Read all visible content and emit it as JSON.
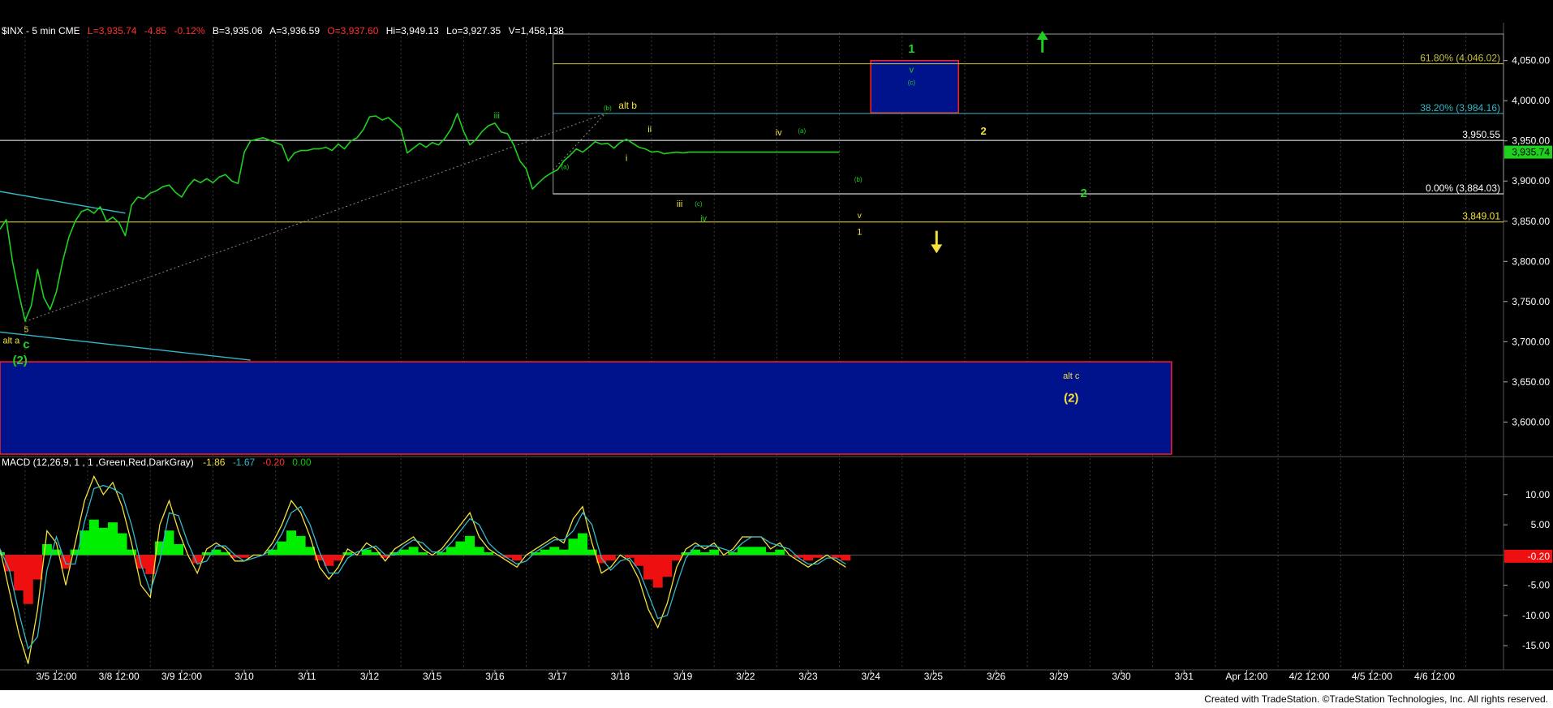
{
  "header": {
    "symbol": "$INX - 5 min  CME",
    "last": "L=3,935.74",
    "change": "-4.85",
    "pct": "-0.12%",
    "bid": "B=3,935.06",
    "ask": "A=3,936.59",
    "open": "O=3,937.60",
    "hi": "Hi=3,949.13",
    "lo": "Lo=3,927.35",
    "vol": "V=1,458,138"
  },
  "footer": {
    "text": "Created with TradeStation. ©TradeStation Technologies, Inc. All rights reserved."
  },
  "colors": {
    "price": "#1fd01f",
    "yellow": "#f2e23a",
    "cyan": "#33b8c8",
    "white": "#ffffff",
    "blue_box": "#00128c",
    "red": "#ff2020",
    "macd_green": "#00ee00",
    "macd_red": "#ee1010"
  },
  "chart_data": [
    {
      "type": "line",
      "title": "",
      "ylim": [
        3560,
        4085
      ],
      "y_ticks": [
        "4,050.00",
        "4,000.00",
        "3,950.00",
        "3,900.00",
        "3,850.00",
        "3,800.00",
        "3,750.00",
        "3,700.00",
        "3,650.00",
        "3,600.00"
      ],
      "y_tick_values": [
        4050,
        4000,
        3950,
        3900,
        3850,
        3800,
        3750,
        3700,
        3650,
        3600
      ],
      "x_ticks": [
        "3/5 12:00",
        "3/8 12:00",
        "3/9 12:00",
        "3/10",
        "3/11",
        "3/12",
        "3/15",
        "3/16",
        "3/17",
        "3/18",
        "3/19",
        "3/22",
        "3/23",
        "3/24",
        "3/25",
        "3/26",
        "3/29",
        "3/30",
        "3/31",
        "Apr 12:00",
        "4/2 12:00",
        "4/5 12:00",
        "4/6 12:00"
      ],
      "x_tick_pos": [
        0.5,
        1.5,
        2.5,
        3.5,
        4.5,
        5.5,
        6.5,
        7.5,
        8.5,
        9.5,
        10.5,
        11.5,
        12.5,
        13.5,
        14.5,
        15.5,
        16.5,
        17.5,
        18.5,
        19.5,
        20.5,
        21.5,
        22.5
      ],
      "xlim": [
        -0.4,
        23.6
      ],
      "series": [
        {
          "x": [
            -0.4,
            -0.3,
            -0.2,
            -0.1,
            0.0,
            0.1,
            0.2,
            0.3,
            0.4,
            0.5,
            0.6,
            0.7,
            0.8,
            0.9,
            1.0,
            1.1,
            1.2,
            1.3,
            1.4,
            1.5,
            1.6,
            1.7,
            1.8,
            1.9,
            2.0,
            2.1,
            2.2,
            2.3,
            2.4,
            2.5,
            2.6,
            2.7,
            2.8,
            2.9,
            3.0,
            3.1,
            3.2,
            3.3,
            3.4,
            3.5,
            3.6,
            3.7,
            3.8,
            3.9,
            4.0,
            4.1,
            4.2,
            4.3,
            4.4,
            4.5,
            4.6,
            4.7,
            4.8,
            4.9,
            5.0,
            5.1,
            5.2,
            5.3,
            5.4,
            5.5,
            5.6,
            5.7,
            5.8,
            5.9,
            6.0,
            6.1,
            6.2,
            6.3,
            6.4,
            6.5,
            6.6,
            6.7,
            6.8,
            6.9,
            7.0,
            7.1,
            7.2,
            7.3,
            7.4,
            7.5,
            7.6,
            7.7,
            7.8,
            7.9,
            8.0,
            8.1,
            8.2,
            8.3,
            8.4,
            8.5,
            8.6,
            8.7,
            8.8,
            8.9,
            9.0,
            9.1,
            9.2,
            9.3,
            9.4,
            9.5,
            9.6,
            9.7,
            9.8,
            9.9,
            10.0,
            10.1,
            10.2,
            10.3,
            10.4,
            10.5,
            10.6,
            10.7,
            10.8,
            10.9,
            11.0,
            11.1,
            11.2,
            11.3,
            11.4,
            11.5,
            11.6,
            11.7,
            11.8,
            11.9,
            12.0,
            12.1,
            12.2,
            12.3,
            12.4,
            12.5,
            12.6,
            12.7,
            12.8,
            12.9,
            13.0
          ],
          "y": [
            3840,
            3852,
            3800,
            3760,
            3726,
            3745,
            3790,
            3755,
            3740,
            3762,
            3800,
            3830,
            3850,
            3862,
            3865,
            3860,
            3868,
            3850,
            3855,
            3848,
            3832,
            3870,
            3880,
            3878,
            3885,
            3888,
            3893,
            3895,
            3886,
            3880,
            3893,
            3902,
            3898,
            3903,
            3898,
            3905,
            3908,
            3900,
            3897,
            3936,
            3950,
            3952,
            3954,
            3951,
            3948,
            3945,
            3925,
            3935,
            3938,
            3938,
            3940,
            3940,
            3942,
            3938,
            3946,
            3940,
            3950,
            3954,
            3964,
            3980,
            3981,
            3976,
            3979,
            3972,
            3965,
            3935,
            3941,
            3947,
            3942,
            3948,
            3945,
            3953,
            3965,
            3984,
            3962,
            3945,
            3952,
            3962,
            3969,
            3972,
            3961,
            3959,
            3945,
            3925,
            3915,
            3890,
            3898,
            3905,
            3910,
            3914,
            3925,
            3932,
            3940,
            3936,
            3942,
            3949,
            3946,
            3947,
            3941,
            3948,
            3952,
            3947,
            3942,
            3940,
            3936,
            3937,
            3934,
            3935,
            3936,
            3935,
            3936,
            3936,
            3936,
            3936,
            3936,
            3936,
            3936,
            3936,
            3936,
            3936,
            3936,
            3936,
            3936,
            3936,
            3936,
            3936,
            3936,
            3936,
            3936,
            3936,
            3936,
            3936,
            3936,
            3936,
            3936
          ],
          "name": ""
        }
      ],
      "horizontal_lines": [
        {
          "value": 3950.55,
          "label": "3,950.55",
          "color": "white"
        },
        {
          "value": 3849.01,
          "label": "3,849.01",
          "color": "yellow"
        }
      ],
      "fib_box": {
        "x0": 8.43,
        "x1": 23.6,
        "top": 4083,
        "bottom": 3884.03
      },
      "fib_levels": [
        {
          "value": 4046.02,
          "label": "61.80% (4,046.02)",
          "color": "#c8c040"
        },
        {
          "value": 3984.16,
          "label": "38.20% (3,984.16)",
          "color": "#33b8c8"
        },
        {
          "value": 3884.03,
          "label": "0.00% (3,884.03)",
          "color": "#ffffff"
        }
      ],
      "current_value_label": "3,935.74",
      "target_boxes": [
        {
          "x0": 13.5,
          "x1": 14.9,
          "top": 4050,
          "bottom": 3985,
          "border": "#ff2020"
        },
        {
          "x0": -0.4,
          "x1": 18.3,
          "top": 3675,
          "bottom": 3560,
          "border": "#ff2020"
        }
      ],
      "wave_labels": [
        {
          "text": "1",
          "x": 14.15,
          "y": 4060,
          "color": "green",
          "size": 15
        },
        {
          "text": "v",
          "x": 14.15,
          "y": 4035,
          "color": "green",
          "size": 11
        },
        {
          "text": "(c)",
          "x": 14.15,
          "y": 4020,
          "color": "green",
          "size": 8
        },
        {
          "text": "(b)",
          "x": 9.3,
          "y": 3988,
          "color": "green",
          "size": 8
        },
        {
          "text": "alt b",
          "x": 9.62,
          "y": 3990,
          "color": "yellow",
          "size": 12
        },
        {
          "text": "iii",
          "x": 7.53,
          "y": 3978,
          "color": "green",
          "size": 11
        },
        {
          "text": "ii",
          "x": 9.97,
          "y": 3961,
          "color": "yellow",
          "size": 11
        },
        {
          "text": "iv",
          "x": 12.03,
          "y": 3957,
          "color": "yellow",
          "size": 11
        },
        {
          "text": "(a)",
          "x": 12.4,
          "y": 3960,
          "color": "green",
          "size": 8
        },
        {
          "text": "2",
          "x": 15.3,
          "y": 3958,
          "color": "yellow",
          "size": 13
        },
        {
          "text": "i",
          "x": 9.6,
          "y": 3925,
          "color": "yellow",
          "size": 11
        },
        {
          "text": "(a)",
          "x": 8.62,
          "y": 3915,
          "color": "green",
          "size": 8
        },
        {
          "text": "(b)",
          "x": 13.3,
          "y": 3899,
          "color": "green",
          "size": 8
        },
        {
          "text": "2",
          "x": 16.9,
          "y": 3880,
          "color": "green",
          "size": 15
        },
        {
          "text": "iii",
          "x": 10.45,
          "y": 3868,
          "color": "yellow",
          "size": 11
        },
        {
          "text": "(c)",
          "x": 10.75,
          "y": 3869,
          "color": "green",
          "size": 8
        },
        {
          "text": "v",
          "x": 13.32,
          "y": 3854,
          "color": "yellow",
          "size": 10
        },
        {
          "text": "iv",
          "x": 10.83,
          "y": 3850,
          "color": "green",
          "size": 11
        },
        {
          "text": "1",
          "x": 13.32,
          "y": 3833,
          "color": "yellow",
          "size": 11
        },
        {
          "text": "5",
          "x": 0.02,
          "y": 3712,
          "color": "yellow",
          "size": 10
        },
        {
          "text": "alt a",
          "x": -0.22,
          "y": 3698,
          "color": "yellow",
          "size": 11
        },
        {
          "text": "c",
          "x": 0.02,
          "y": 3692,
          "color": "green",
          "size": 15
        },
        {
          "text": "(2)",
          "x": -0.08,
          "y": 3672,
          "color": "green",
          "size": 15
        },
        {
          "text": "alt c",
          "x": 16.7,
          "y": 3654,
          "color": "yellow",
          "size": 11
        },
        {
          "text": "(2)",
          "x": 16.7,
          "y": 3625,
          "color": "yellow",
          "size": 15
        }
      ],
      "arrows": [
        {
          "direction": "up",
          "x": 16.24,
          "y_tail": 4060,
          "y_head": 4085,
          "color": "green"
        },
        {
          "direction": "down",
          "x": 14.55,
          "y_tail": 3838,
          "y_head": 3812,
          "color": "yellow"
        }
      ],
      "trendlines": [
        {
          "x0": -0.4,
          "y0": 3887,
          "x1": 1.6,
          "y1": 3860,
          "color": "cyan"
        },
        {
          "x0": -0.4,
          "y0": 3712,
          "x1": 3.6,
          "y1": 3677,
          "color": "cyan"
        },
        {
          "x0": 0.0,
          "y0": 3725,
          "x1": 9.3,
          "y1": 3985,
          "color": "gray-dotted"
        },
        {
          "x0": 8.43,
          "y0": 3914,
          "x1": 9.25,
          "y1": 3983,
          "color": "gray-dotted"
        }
      ],
      "grid": true
    },
    {
      "type": "line",
      "title": "",
      "legend": "MACD (12,26,9, 1 , 1 ,Green,Red,DarkGray)",
      "legend_values": [
        "-1.86",
        "-1.67",
        "-0.20",
        "0.00"
      ],
      "ylim": [
        -19,
        14
      ],
      "y_ticks": [
        "10.00",
        "5.00",
        "-5.00",
        "-10.00",
        "-15.00"
      ],
      "y_tick_values": [
        10,
        5,
        -5,
        -10,
        -15
      ],
      "current_value_label": "-0.20",
      "xlim": [
        -0.4,
        23.6
      ],
      "series": [
        {
          "name": "",
          "x": [
            -0.4,
            -0.25,
            -0.1,
            0.05,
            0.2,
            0.35,
            0.5,
            0.65,
            0.8,
            0.95,
            1.1,
            1.25,
            1.4,
            1.55,
            1.7,
            1.85,
            2.0,
            2.15,
            2.3,
            2.45,
            2.6,
            2.75,
            2.9,
            3.05,
            3.2,
            3.35,
            3.5,
            3.65,
            3.8,
            3.95,
            4.1,
            4.25,
            4.4,
            4.55,
            4.7,
            4.85,
            5.0,
            5.15,
            5.3,
            5.45,
            5.6,
            5.75,
            5.9,
            6.05,
            6.2,
            6.35,
            6.5,
            6.65,
            6.8,
            6.95,
            7.1,
            7.25,
            7.4,
            7.55,
            7.7,
            7.85,
            8.0,
            8.15,
            8.3,
            8.45,
            8.6,
            8.75,
            8.9,
            9.05,
            9.2,
            9.35,
            9.5,
            9.65,
            9.8,
            9.95,
            10.1,
            10.25,
            10.4,
            10.55,
            10.7,
            10.85,
            11.0,
            11.15,
            11.3,
            11.45,
            11.6,
            11.75,
            11.9,
            12.05,
            12.2,
            12.35,
            12.5,
            12.65,
            12.8,
            12.95,
            13.1
          ],
          "y": [
            1,
            -6,
            -13,
            -18,
            -9,
            4,
            2,
            -5,
            2,
            9,
            13,
            10,
            12,
            8,
            2,
            -5,
            -7,
            5,
            9,
            4,
            0,
            -3,
            1,
            2,
            1,
            -1,
            -1,
            0,
            0,
            2,
            5,
            9,
            7,
            3,
            -2,
            -4,
            -2,
            1,
            0,
            2,
            1,
            -1,
            1,
            2,
            3,
            1,
            0,
            1,
            3,
            5,
            7,
            3,
            1,
            0,
            -1,
            -2,
            0,
            1,
            2,
            3,
            2,
            6,
            8,
            2,
            -3,
            -2,
            0,
            -1,
            -4,
            -9,
            -12,
            -8,
            -2,
            1,
            2,
            1,
            2,
            0,
            1,
            3,
            3,
            3,
            1,
            2,
            0,
            -1,
            -2,
            -1,
            0,
            -1,
            -2
          ]
        }
      ],
      "grid": true
    }
  ]
}
